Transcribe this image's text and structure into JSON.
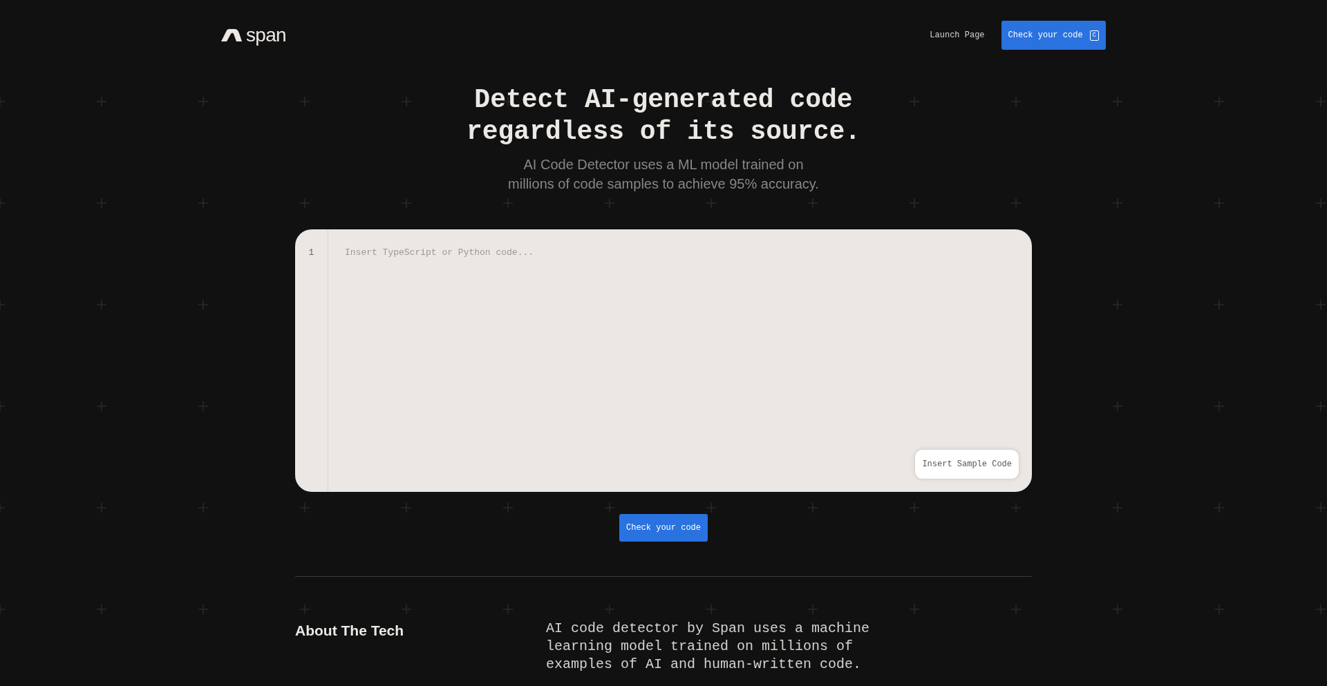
{
  "header": {
    "logo": "span",
    "links": [
      {
        "label": "Launch Page"
      }
    ],
    "cta": {
      "label": "Check your code",
      "shortcut": "C"
    }
  },
  "hero": {
    "title_lines": [
      "Detect AI-generated code",
      "regardless of its source."
    ],
    "subtitle_lines": [
      "AI Code Detector uses a ML model trained on",
      "millions of code samples to achieve 95% accuracy."
    ]
  },
  "editor": {
    "line_numbers": [
      "1"
    ],
    "placeholder": "Insert TypeScript or Python code...",
    "sample_button": "Insert Sample Code"
  },
  "submit_button": "Check your code",
  "about": {
    "heading": "About The Tech",
    "body_lines": [
      "AI code detector by Span uses a machine",
      "learning model trained on millions of",
      "examples of AI and human-written code."
    ]
  }
}
